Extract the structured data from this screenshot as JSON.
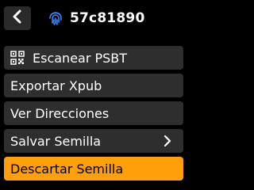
{
  "header": {
    "title": "57c81890",
    "back_icon": "chevron-left-icon",
    "title_icon": "fingerprint-icon"
  },
  "menu": {
    "items": [
      {
        "label": "Escanear PSBT",
        "icon": "qr-code-icon"
      },
      {
        "label": "Exportar Xpub"
      },
      {
        "label": "Ver Direcciones"
      },
      {
        "label": "Salvar Semilla",
        "icon": "chevron-right-icon"
      },
      {
        "label": "Descartar Semilla",
        "selected": true
      }
    ]
  },
  "colors": {
    "background": "#000000",
    "button": "#2e2e2e",
    "accent": "#ff9f0a",
    "fingerprint": "#3a86ff"
  }
}
